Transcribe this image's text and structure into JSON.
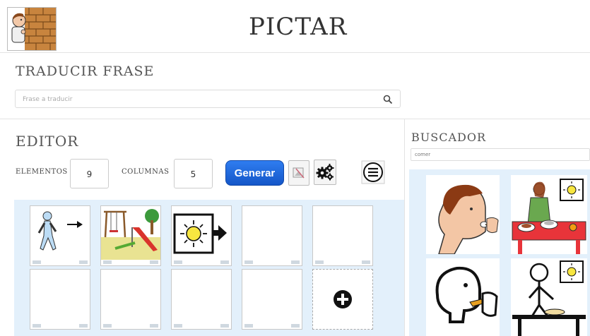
{
  "header": {
    "title": "PICTAR",
    "logo_icon": "child-behind-brick-wall-icon"
  },
  "translate": {
    "title": "TRADUCIR FRASE",
    "placeholder": "Frase a traducir",
    "search_icon": "search-icon"
  },
  "editor": {
    "title": "EDITOR",
    "elements_label": "ELEMENTOS",
    "elements_value": "9",
    "columns_label": "COLUMNAS",
    "columns_value": "5",
    "generate_label": "Generar",
    "tool_icons": [
      "image-edit-icon",
      "gears-icon",
      "menu-icon"
    ],
    "cells": [
      {
        "icon": "walk-pictogram"
      },
      {
        "icon": "playground-pictogram"
      },
      {
        "icon": "day-pictogram"
      },
      {
        "icon": ""
      },
      {
        "icon": ""
      },
      {
        "icon": ""
      },
      {
        "icon": ""
      },
      {
        "icon": ""
      },
      {
        "icon": ""
      },
      {
        "icon": "add-icon"
      }
    ]
  },
  "finder": {
    "title": "BUSCADOR",
    "query": "comer",
    "results": [
      "eat-pictogram",
      "lunch-pictogram",
      "eat-outline-pictogram",
      "breakfast-pictogram"
    ]
  },
  "colors": {
    "accent_blue": "#1f6ae0",
    "grid_bg": "#e3f0fb"
  }
}
